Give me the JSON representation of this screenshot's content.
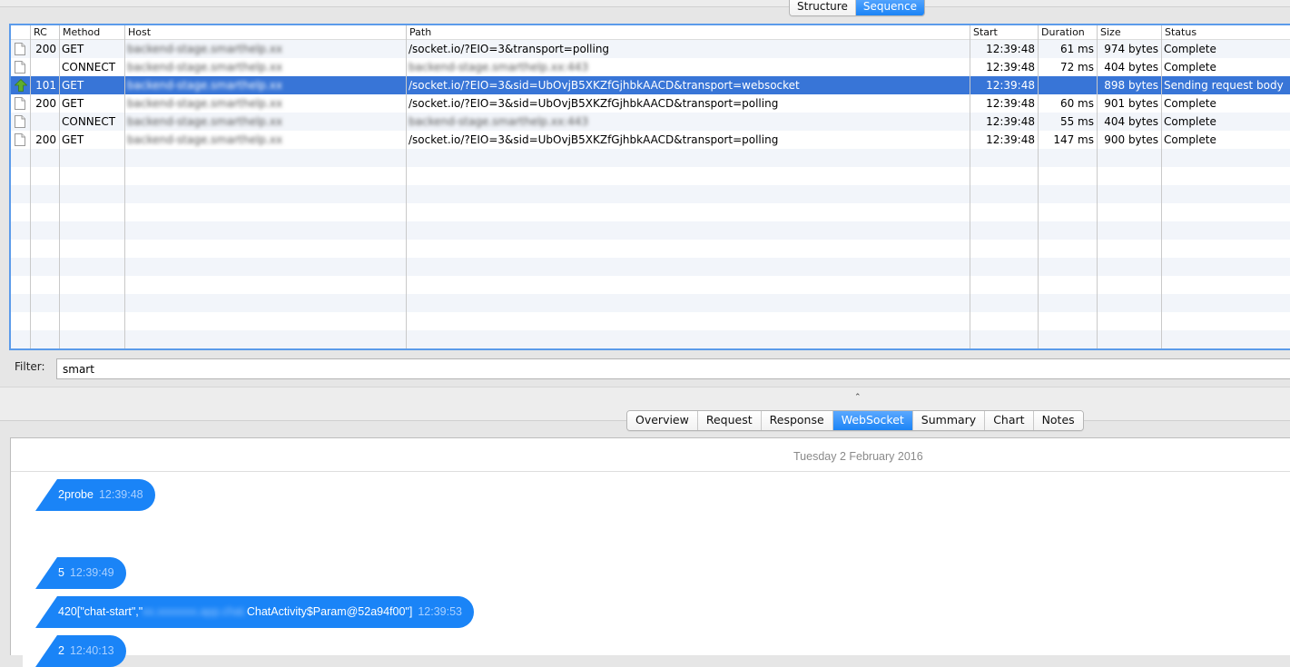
{
  "view_switcher": {
    "options": [
      "Structure",
      "Sequence"
    ],
    "active": "Sequence"
  },
  "table": {
    "columns": [
      "",
      "RC",
      "Method",
      "Host",
      "Path",
      "Start",
      "Duration",
      "Size",
      "Status"
    ],
    "rows": [
      {
        "icon": "document-icon",
        "rc": "200",
        "method": "GET",
        "host": "backend-stage.smarthelp.xx",
        "host_redacted": true,
        "path": "/socket.io/?EIO=3&transport=polling",
        "path_redacted": false,
        "start": "12:39:48",
        "duration": "61 ms",
        "size": "974 bytes",
        "status": "Complete",
        "selected": false
      },
      {
        "icon": "document-icon",
        "rc": "",
        "method": "CONNECT",
        "host": "backend-stage.smarthelp.xx",
        "host_redacted": true,
        "path": "backend-stage.smarthelp.xx:443",
        "path_redacted": true,
        "start": "12:39:48",
        "duration": "72 ms",
        "size": "404 bytes",
        "status": "Complete",
        "selected": false
      },
      {
        "icon": "upload-arrow-icon",
        "rc": "101",
        "method": "GET",
        "host": "backend-stage.smarthelp.xx",
        "host_redacted": true,
        "path": "/socket.io/?EIO=3&sid=UbOvjB5XKZfGjhbkAACD&transport=websocket",
        "path_redacted": false,
        "start": "12:39:48",
        "duration": "",
        "size": "898 bytes",
        "status": "Sending request body",
        "selected": true
      },
      {
        "icon": "document-icon",
        "rc": "200",
        "method": "GET",
        "host": "backend-stage.smarthelp.xx",
        "host_redacted": true,
        "path": "/socket.io/?EIO=3&sid=UbOvjB5XKZfGjhbkAACD&transport=polling",
        "path_redacted": false,
        "start": "12:39:48",
        "duration": "60 ms",
        "size": "901 bytes",
        "status": "Complete",
        "selected": false
      },
      {
        "icon": "document-icon",
        "rc": "",
        "method": "CONNECT",
        "host": "backend-stage.smarthelp.xx",
        "host_redacted": true,
        "path": "backend-stage.smarthelp.xx:443",
        "path_redacted": true,
        "start": "12:39:48",
        "duration": "55 ms",
        "size": "404 bytes",
        "status": "Complete",
        "selected": false
      },
      {
        "icon": "document-icon",
        "rc": "200",
        "method": "GET",
        "host": "backend-stage.smarthelp.xx",
        "host_redacted": true,
        "path": "/socket.io/?EIO=3&sid=UbOvjB5XKZfGjhbkAACD&transport=polling",
        "path_redacted": false,
        "start": "12:39:48",
        "duration": "147 ms",
        "size": "900 bytes",
        "status": "Complete",
        "selected": false
      }
    ]
  },
  "filter": {
    "label": "Filter:",
    "value": "smart"
  },
  "detail_tabs": {
    "options": [
      "Overview",
      "Request",
      "Response",
      "WebSocket",
      "Summary",
      "Chart",
      "Notes"
    ],
    "active": "WebSocket"
  },
  "websocket": {
    "date_header": "Tuesday 2 February 2016",
    "messages": [
      {
        "text": "2probe",
        "time": "12:39:48"
      },
      {
        "text": "5",
        "time": "12:39:49"
      },
      {
        "text_prefix": "420[\"chat-start\",\"",
        "text_redacted": "xx.xxxxxxx.app.chat.",
        "text_suffix": "ChatActivity$Param@52a94f00\"]",
        "time": "12:39:53"
      },
      {
        "text": "2",
        "time": "12:40:13"
      }
    ]
  },
  "colors": {
    "accent": "#1a84f7",
    "selection": "#3875d7",
    "table_border": "#5b9bea"
  }
}
